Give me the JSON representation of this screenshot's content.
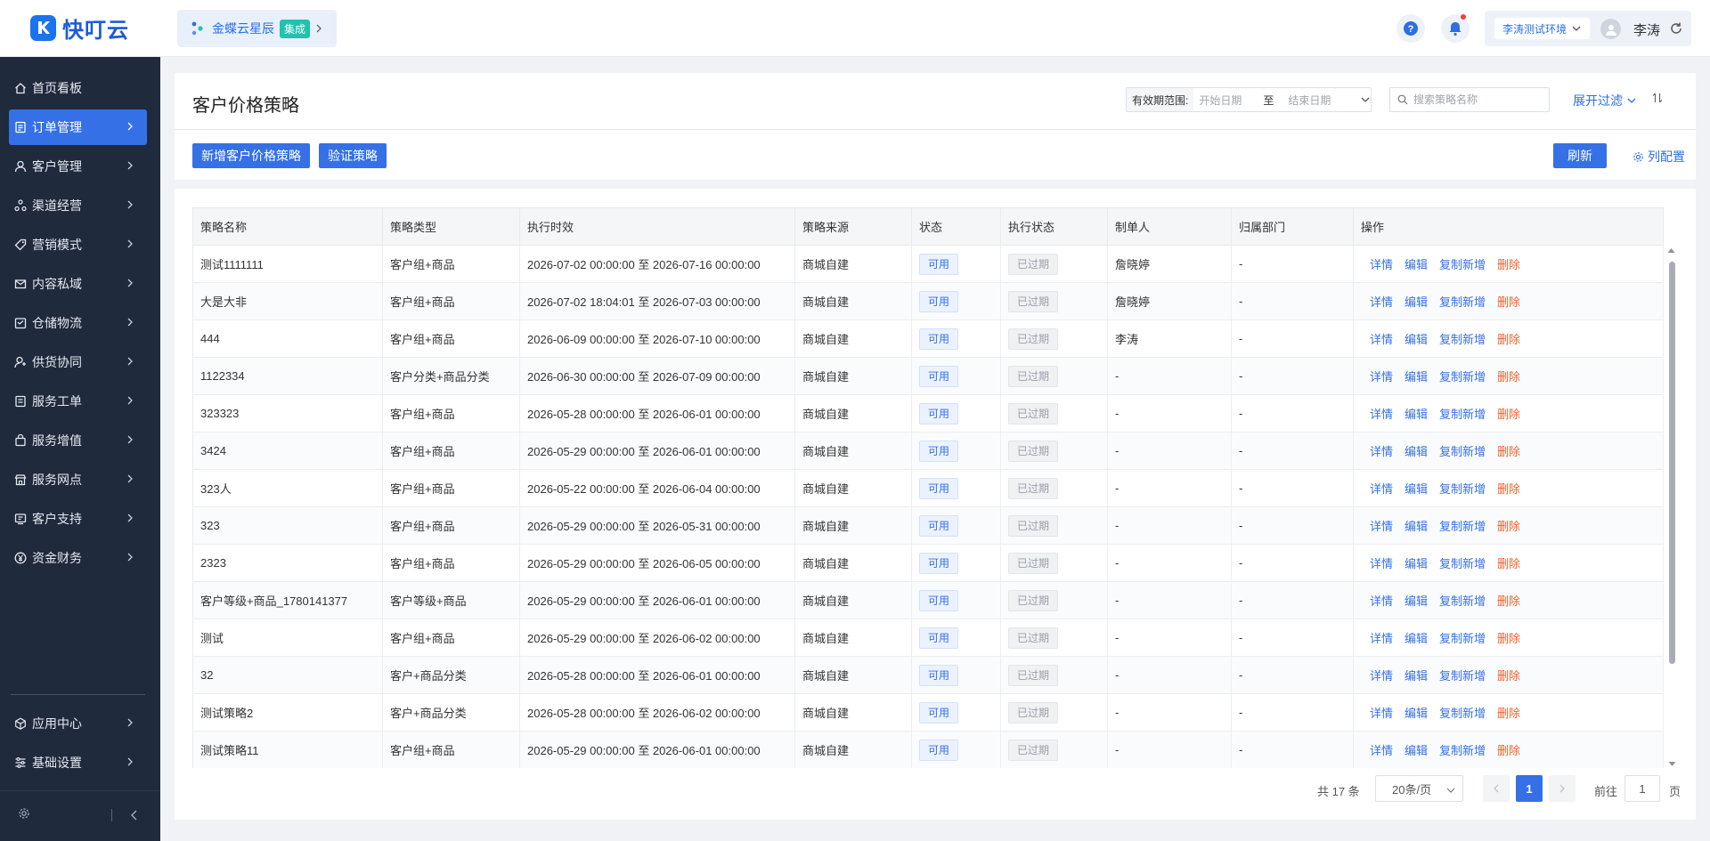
{
  "brand": {
    "name": "快叮云"
  },
  "app_switcher": {
    "label": "金蝶云星辰",
    "badge": "集成"
  },
  "user": {
    "environment": "李涛测试环境",
    "name": "李涛"
  },
  "sidebar": {
    "items": [
      {
        "label": "首页看板",
        "icon": "home-icon"
      },
      {
        "label": "订单管理",
        "icon": "document-icon",
        "active": true
      },
      {
        "label": "客户管理",
        "icon": "user-icon"
      },
      {
        "label": "渠道经营",
        "icon": "channel-icon"
      },
      {
        "label": "营销模式",
        "icon": "tag-icon"
      },
      {
        "label": "内容私域",
        "icon": "envelope-icon"
      },
      {
        "label": "仓储物流",
        "icon": "warehouse-icon"
      },
      {
        "label": "供货协同",
        "icon": "supplier-icon"
      },
      {
        "label": "服务工单",
        "icon": "ticket-icon"
      },
      {
        "label": "服务增值",
        "icon": "bag-icon"
      },
      {
        "label": "服务网点",
        "icon": "store-icon"
      },
      {
        "label": "客户支持",
        "icon": "support-icon"
      },
      {
        "label": "资金财务",
        "icon": "yen-icon"
      }
    ],
    "bottom_items": [
      {
        "label": "应用中心",
        "icon": "cube-icon"
      },
      {
        "label": "基础设置",
        "icon": "settings-list-icon"
      }
    ]
  },
  "page": {
    "title": "客户价格策略",
    "date_range": {
      "label": "有效期范围:",
      "start_placeholder": "开始日期",
      "separator": "至",
      "end_placeholder": "结束日期"
    },
    "search_placeholder": "搜索策略名称",
    "expand_filter": "展开过滤",
    "buttons": {
      "add": "新增客户价格策略",
      "verify": "验证策略",
      "refresh": "刷新",
      "column_config": "列配置"
    }
  },
  "table": {
    "columns": [
      "策略名称",
      "策略类型",
      "执行时效",
      "策略来源",
      "状态",
      "执行状态",
      "制单人",
      "归属部门",
      "操作"
    ],
    "actions": {
      "detail": "详情",
      "edit": "编辑",
      "copy": "复制新增",
      "delete": "删除"
    },
    "rows": [
      {
        "name": "测试1111111",
        "type": "客户组+商品",
        "period": "2026-07-02 00:00:00 至 2026-07-16 00:00:00",
        "source": "商城自建",
        "status": "可用",
        "exec_status": "已过期",
        "creator": "詹晓婷",
        "dept": "-"
      },
      {
        "name": "大是大非",
        "type": "客户组+商品",
        "period": "2026-07-02 18:04:01 至 2026-07-03 00:00:00",
        "source": "商城自建",
        "status": "可用",
        "exec_status": "已过期",
        "creator": "詹晓婷",
        "dept": "-"
      },
      {
        "name": "444",
        "type": "客户组+商品",
        "period": "2026-06-09 00:00:00 至 2026-07-10 00:00:00",
        "source": "商城自建",
        "status": "可用",
        "exec_status": "已过期",
        "creator": "李涛",
        "dept": "-"
      },
      {
        "name": "1122334",
        "type": "客户分类+商品分类",
        "period": "2026-06-30 00:00:00 至 2026-07-09 00:00:00",
        "source": "商城自建",
        "status": "可用",
        "exec_status": "已过期",
        "creator": "-",
        "dept": "-"
      },
      {
        "name": "323323",
        "type": "客户组+商品",
        "period": "2026-05-28 00:00:00 至 2026-06-01 00:00:00",
        "source": "商城自建",
        "status": "可用",
        "exec_status": "已过期",
        "creator": "-",
        "dept": "-"
      },
      {
        "name": "3424",
        "type": "客户组+商品",
        "period": "2026-05-29 00:00:00 至 2026-06-01 00:00:00",
        "source": "商城自建",
        "status": "可用",
        "exec_status": "已过期",
        "creator": "-",
        "dept": "-"
      },
      {
        "name": "323人",
        "type": "客户组+商品",
        "period": "2026-05-22 00:00:00 至 2026-06-04 00:00:00",
        "source": "商城自建",
        "status": "可用",
        "exec_status": "已过期",
        "creator": "-",
        "dept": "-"
      },
      {
        "name": "323",
        "type": "客户组+商品",
        "period": "2026-05-29 00:00:00 至 2026-05-31 00:00:00",
        "source": "商城自建",
        "status": "可用",
        "exec_status": "已过期",
        "creator": "-",
        "dept": "-"
      },
      {
        "name": "2323",
        "type": "客户组+商品",
        "period": "2026-05-29 00:00:00 至 2026-06-05 00:00:00",
        "source": "商城自建",
        "status": "可用",
        "exec_status": "已过期",
        "creator": "-",
        "dept": "-"
      },
      {
        "name": "客户等级+商品_1780141377",
        "type": "客户等级+商品",
        "period": "2026-05-29 00:00:00 至 2026-06-01 00:00:00",
        "source": "商城自建",
        "status": "可用",
        "exec_status": "已过期",
        "creator": "-",
        "dept": "-"
      },
      {
        "name": "测试",
        "type": "客户组+商品",
        "period": "2026-05-29 00:00:00 至 2026-06-02 00:00:00",
        "source": "商城自建",
        "status": "可用",
        "exec_status": "已过期",
        "creator": "-",
        "dept": "-"
      },
      {
        "name": "32",
        "type": "客户+商品分类",
        "period": "2026-05-28 00:00:00 至 2026-06-01 00:00:00",
        "source": "商城自建",
        "status": "可用",
        "exec_status": "已过期",
        "creator": "-",
        "dept": "-"
      },
      {
        "name": "测试策略2",
        "type": "客户+商品分类",
        "period": "2026-05-28 00:00:00 至 2026-06-02 00:00:00",
        "source": "商城自建",
        "status": "可用",
        "exec_status": "已过期",
        "creator": "-",
        "dept": "-"
      },
      {
        "name": "测试策略11",
        "type": "客户组+商品",
        "period": "2026-05-29 00:00:00 至 2026-06-01 00:00:00",
        "source": "商城自建",
        "status": "可用",
        "exec_status": "已过期",
        "creator": "-",
        "dept": "-"
      }
    ]
  },
  "pagination": {
    "total": "共 17 条",
    "page_size": "20条/页",
    "current_page": "1",
    "goto_label": "前往",
    "goto_value": "1",
    "goto_suffix": "页"
  }
}
